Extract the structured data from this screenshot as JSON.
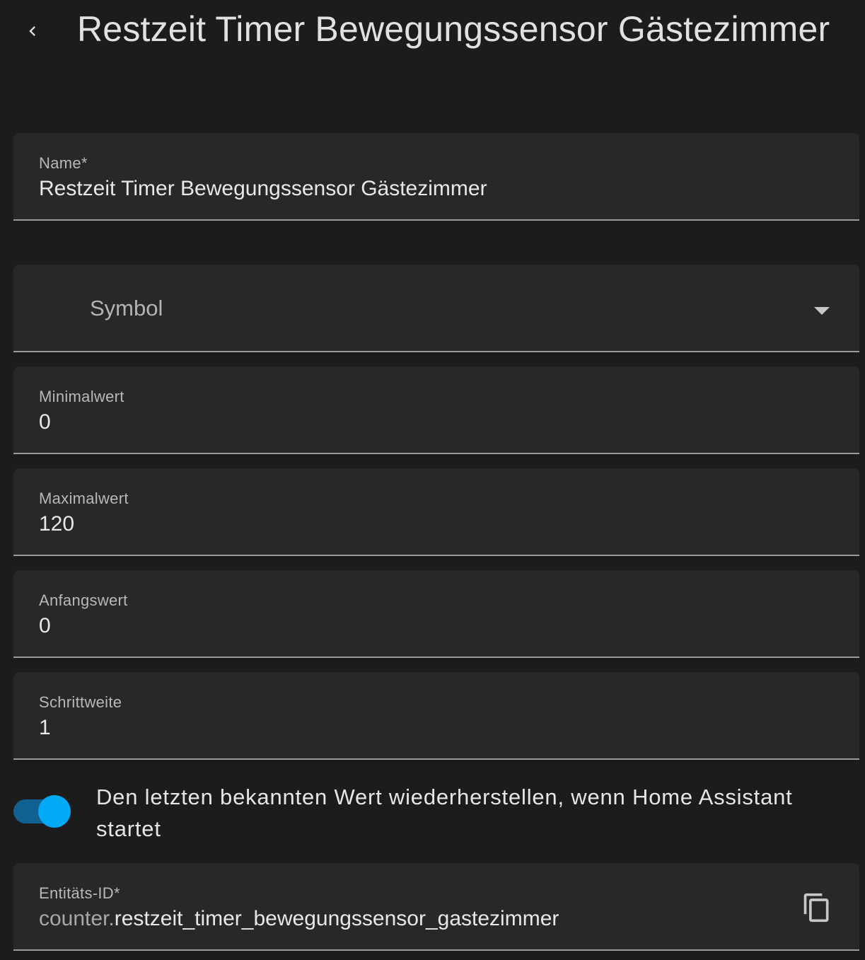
{
  "header": {
    "title": "Restzeit Timer Bewegungssensor Gästezimmer",
    "back_icon": "chevron-left-icon"
  },
  "form": {
    "name": {
      "label": "Name*",
      "value": "Restzeit Timer Bewegungssensor Gästezimmer"
    },
    "icon": {
      "placeholder": "Symbol",
      "caret_icon": "caret-down-icon"
    },
    "minimum": {
      "label": "Minimalwert",
      "value": "0"
    },
    "maximum": {
      "label": "Maximalwert",
      "value": "120"
    },
    "initial": {
      "label": "Anfangswert",
      "value": "0"
    },
    "step": {
      "label": "Schrittweite",
      "value": "1"
    },
    "restore": {
      "label": "Den letzten bekannten Wert wiederherstellen, wenn Home Assistant startet",
      "checked": true
    },
    "entity_id": {
      "label": "Entitäts-ID*",
      "prefix": "counter.",
      "value": "restzeit_timer_bewegungssensor_gastezimmer",
      "copy_icon": "copy-icon"
    }
  },
  "colors": {
    "background": "#1c1c1c",
    "field_background": "#282828",
    "accent": "#03a9f4"
  }
}
